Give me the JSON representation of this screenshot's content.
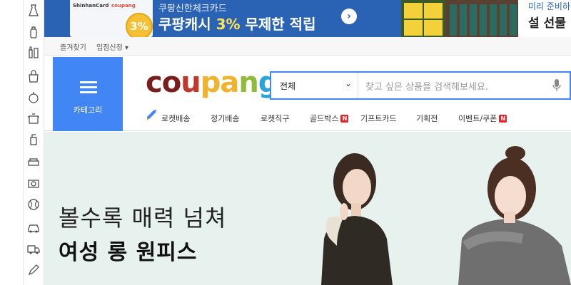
{
  "rail": {
    "icons": [
      "dress-icon",
      "baby-bottle-icon",
      "cosmetics-icon",
      "grocery-bag-icon",
      "apple-icon",
      "cooking-pot-icon",
      "cleaning-spray-icon",
      "sofa-icon",
      "camera-icon",
      "ball-icon",
      "car-icon",
      "truck-icon",
      "pencil-icon"
    ]
  },
  "banner": {
    "card_brand": "ShinhanCard",
    "card_partner": "coupang",
    "coin_text": "3%",
    "subtitle": "쿠팡신한체크카드",
    "headline_pre": "쿠팡캐시 ",
    "headline_pct": "3%",
    "headline_post": " 무제한 적립",
    "right_line1": "미리 준비하",
    "right_line2": "설 선물"
  },
  "subbar": {
    "bookmark": "즐겨찾기",
    "seller": "입점신청 ▾"
  },
  "header": {
    "category_label": "카테고리",
    "logo": {
      "c1": "co",
      "c2": "u",
      "c3": "pa",
      "c4": "n",
      "c5": "g"
    },
    "search": {
      "scope": "전체",
      "placeholder": "찾고 싶은 상품을 검색해보세요."
    },
    "nav": [
      {
        "label": "로켓배송",
        "badge": ""
      },
      {
        "label": "정기배송",
        "badge": ""
      },
      {
        "label": "로켓직구",
        "badge": ""
      },
      {
        "label": "골드박스",
        "badge": "N"
      },
      {
        "label": "기프트카드",
        "badge": ""
      },
      {
        "label": "기획전",
        "badge": ""
      },
      {
        "label": "이벤트/쿠폰",
        "badge": "N"
      }
    ]
  },
  "hero": {
    "line1": "볼수록 매력 넘쳐",
    "line2": "여성 롱 원피스"
  },
  "colors": {
    "accent": "#4285f4",
    "banner_bg": "#2a63b3",
    "hero_bg": "#e7f2ee",
    "badge": "#e52528"
  }
}
